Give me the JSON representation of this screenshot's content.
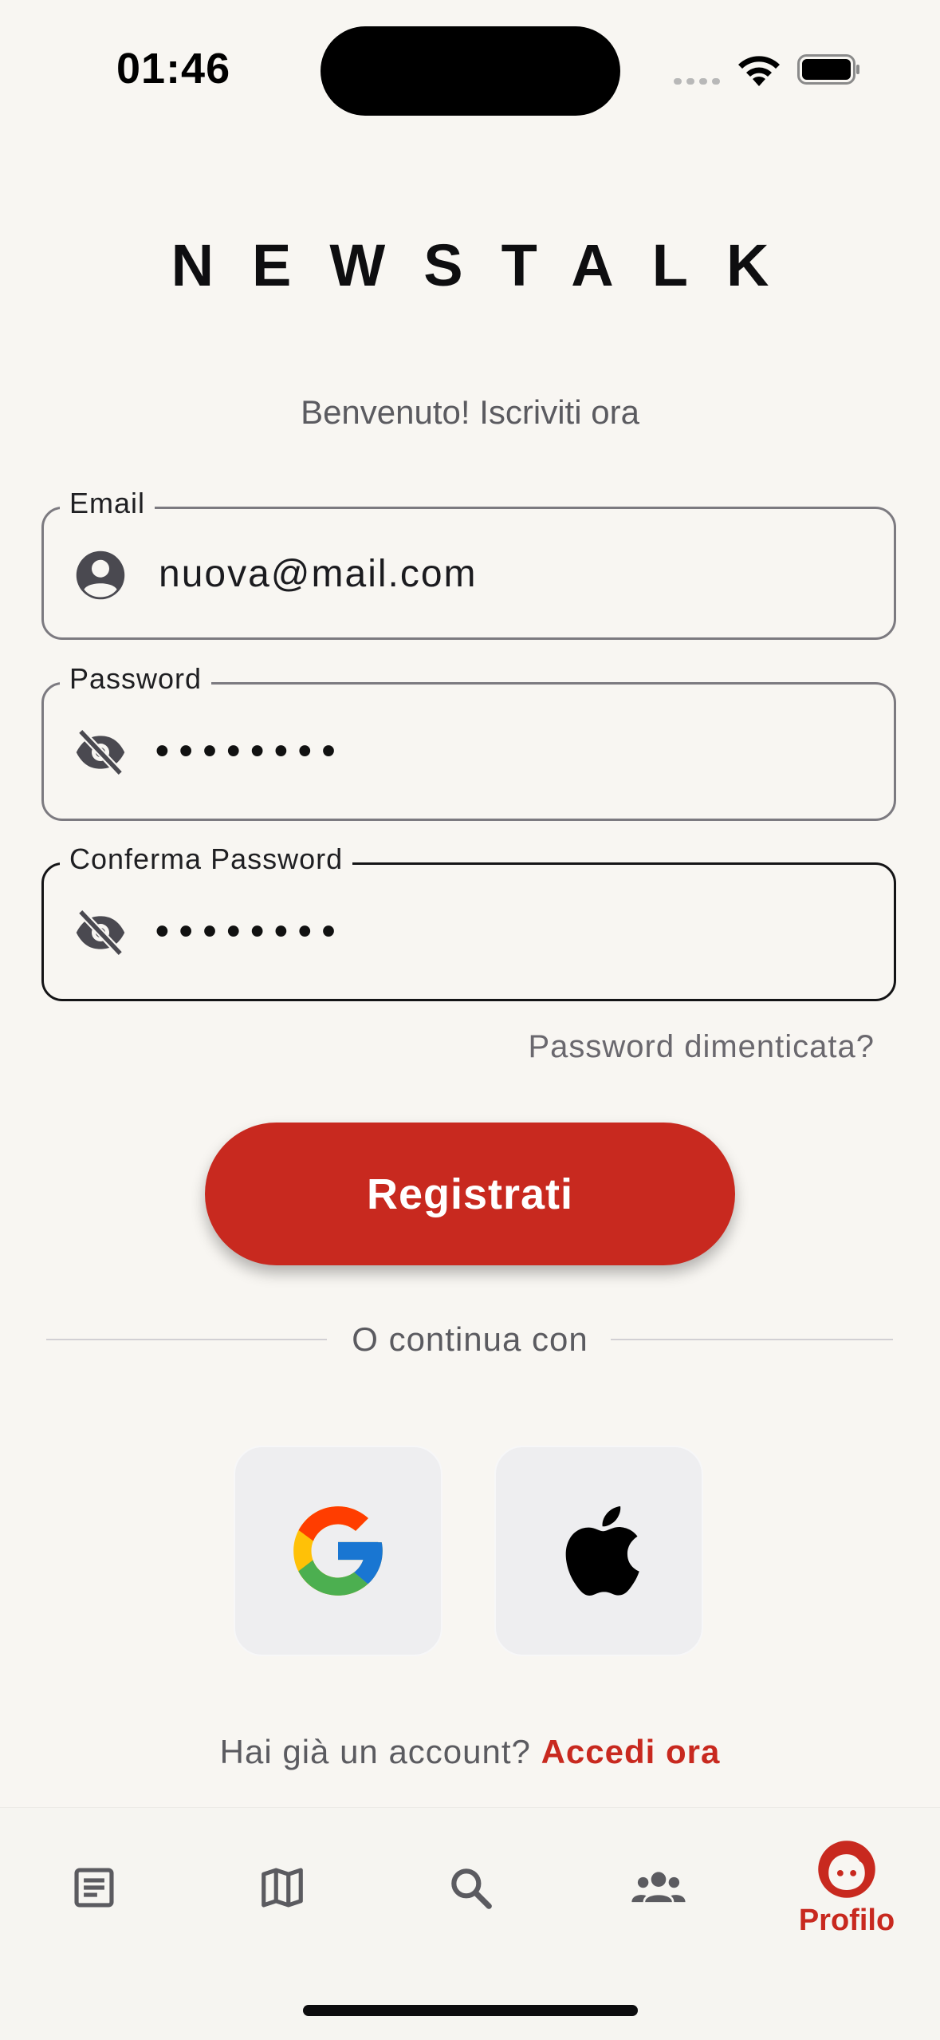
{
  "status_bar": {
    "time": "01:46"
  },
  "app": {
    "logo": "NEWSTALK",
    "subtitle": "Benvenuto! Iscriviti ora"
  },
  "form": {
    "email": {
      "label": "Email",
      "value": "nuova@mail.com",
      "icon": "account-circle-icon"
    },
    "password": {
      "label": "Password",
      "value": "••••••••",
      "icon": "visibility-off-icon"
    },
    "confirm_password": {
      "label": "Conferma Password",
      "value": "••••••••",
      "icon": "visibility-off-icon"
    },
    "forgot_password": "Password dimenticata?",
    "submit_label": "Registrati"
  },
  "divider": {
    "label": "O continua con"
  },
  "social": {
    "google_icon": "google-icon",
    "apple_icon": "apple-icon"
  },
  "login_prompt": {
    "text": "Hai già un account? ",
    "link": "Accedi ora"
  },
  "bottom_nav": {
    "items": [
      {
        "icon": "article-icon",
        "label": ""
      },
      {
        "icon": "map-icon",
        "label": ""
      },
      {
        "icon": "search-icon",
        "label": ""
      },
      {
        "icon": "group-icon",
        "label": ""
      },
      {
        "icon": "profile-icon",
        "label": "Profilo",
        "active": true
      }
    ]
  },
  "colors": {
    "accent": "#c8291f",
    "background": "#f8f6f2",
    "icon_gray": "#5b5b60"
  }
}
